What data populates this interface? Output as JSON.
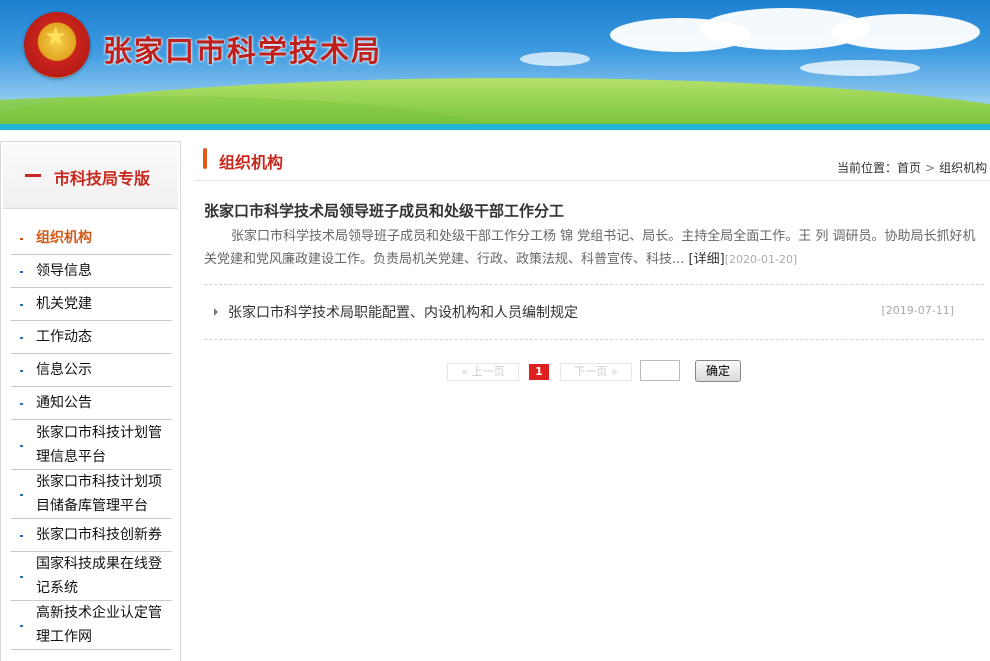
{
  "header": {
    "site_title": "张家口市科学技术局"
  },
  "sidebar": {
    "heading": "市科技局专版",
    "items": [
      {
        "label": "组织机构",
        "active": true
      },
      {
        "label": "领导信息"
      },
      {
        "label": "机关党建"
      },
      {
        "label": "工作动态"
      },
      {
        "label": "信息公示"
      },
      {
        "label": "通知公告"
      },
      {
        "label": "张家口市科技计划管理信息平台"
      },
      {
        "label": "张家口市科技计划项目储备库管理平台"
      },
      {
        "label": "张家口市科技创新券"
      },
      {
        "label": "国家科技成果在线登记系统"
      },
      {
        "label": "高新技术企业认定管理工作网"
      }
    ]
  },
  "main": {
    "section_title": "组织机构",
    "breadcrumb": {
      "prefix": "当前位置：",
      "home": "首页",
      "separator": ">",
      "current": "组织机构"
    },
    "featured": {
      "title": "张家口市科学技术局领导班子成员和处级干部工作分工",
      "summary": "张家口市科学技术局领导班子成员和处级干部工作分工杨 锦 党组书记、局长。主持全局全面工作。王 列 调研员。协助局长抓好机关党建和党风廉政建设工作。负责局机关党建、行政、政策法规、科普宣传、科技...",
      "more_open": "[",
      "more_label": "详细",
      "more_close": "]",
      "date": "[2020-01-20]"
    },
    "list": [
      {
        "title": "张家口市科学技术局职能配置、内设机构和人员编制规定",
        "date": "[2019-07-11]"
      }
    ]
  },
  "pagination": {
    "prev": "« 上一页",
    "current": "1",
    "next": "下一页 »",
    "page_input": "",
    "go": "确定"
  }
}
